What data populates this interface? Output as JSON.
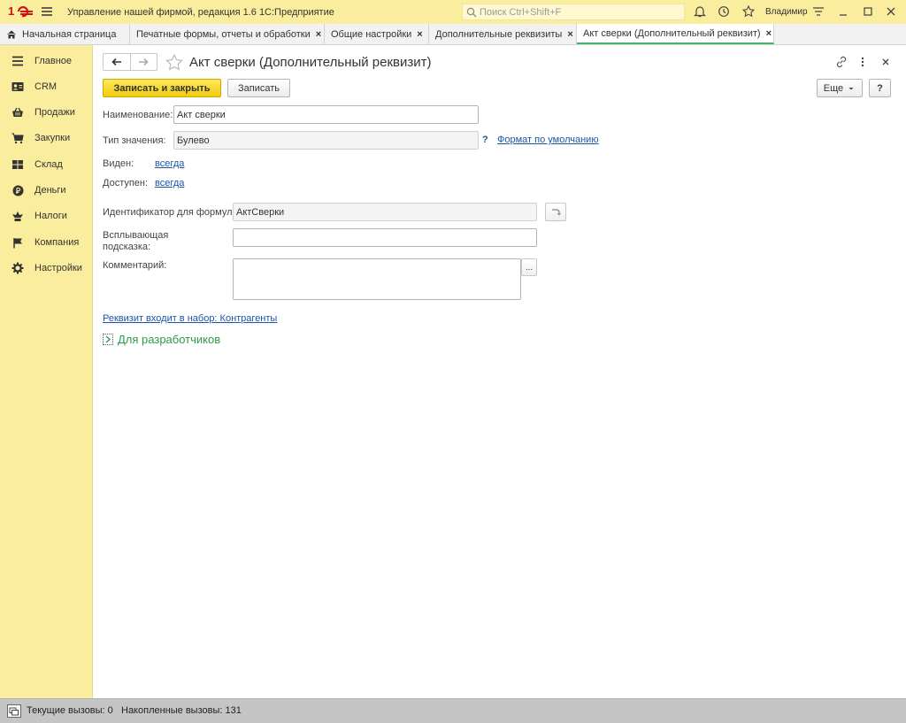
{
  "app": {
    "title": "Управление нашей фирмой, редакция 1.6 1С:Предприятие",
    "search_placeholder": "Поиск Ctrl+Shift+F",
    "user": "Владимир"
  },
  "tabs": [
    {
      "label": "Начальная страница"
    },
    {
      "label": "Печатные формы, отчеты и обработки"
    },
    {
      "label": "Общие настройки"
    },
    {
      "label": "Дополнительные реквизиты"
    },
    {
      "label": "Акт сверки (Дополнительный реквизит)"
    }
  ],
  "sidebar": {
    "items": [
      {
        "label": "Главное",
        "icon": "menu-icon"
      },
      {
        "label": "CRM",
        "icon": "contact-card-icon"
      },
      {
        "label": "Продажи",
        "icon": "basket-icon"
      },
      {
        "label": "Закупки",
        "icon": "cart-icon"
      },
      {
        "label": "Склад",
        "icon": "warehouse-icon"
      },
      {
        "label": "Деньги",
        "icon": "money-icon"
      },
      {
        "label": "Налоги",
        "icon": "taxes-icon"
      },
      {
        "label": "Компания",
        "icon": "flag-icon"
      },
      {
        "label": "Настройки",
        "icon": "gear-icon"
      }
    ]
  },
  "form": {
    "title": "Акт сверки (Дополнительный реквизит)",
    "save_close_label": "Записать и закрыть",
    "save_label": "Записать",
    "more_label": "Еще",
    "help_label": "?",
    "name_label": "Наименование:",
    "name_value": "Акт сверки",
    "type_label": "Тип значения:",
    "type_value": "Булево",
    "type_help": "?",
    "format_link": "Формат по умолчанию",
    "visible_label": "Виден:",
    "visible_value": "всегда",
    "available_label": "Доступен:",
    "available_value": "всегда",
    "formula_id_label": "Идентификатор для формул:",
    "formula_id_value": "АктСверки",
    "tooltip_label_line1": "Всплывающая",
    "tooltip_label_line2": "подсказка:",
    "tooltip_value": "",
    "comment_label": "Комментарий:",
    "comment_value": "",
    "comment_button": "...",
    "set_link": "Реквизит входит в набор: Контрагенты",
    "dev_group": "Для разработчиков"
  },
  "statusbar": {
    "current_calls": "Текущие вызовы: 0",
    "accumulated_calls": "Накопленные вызовы: 131"
  }
}
